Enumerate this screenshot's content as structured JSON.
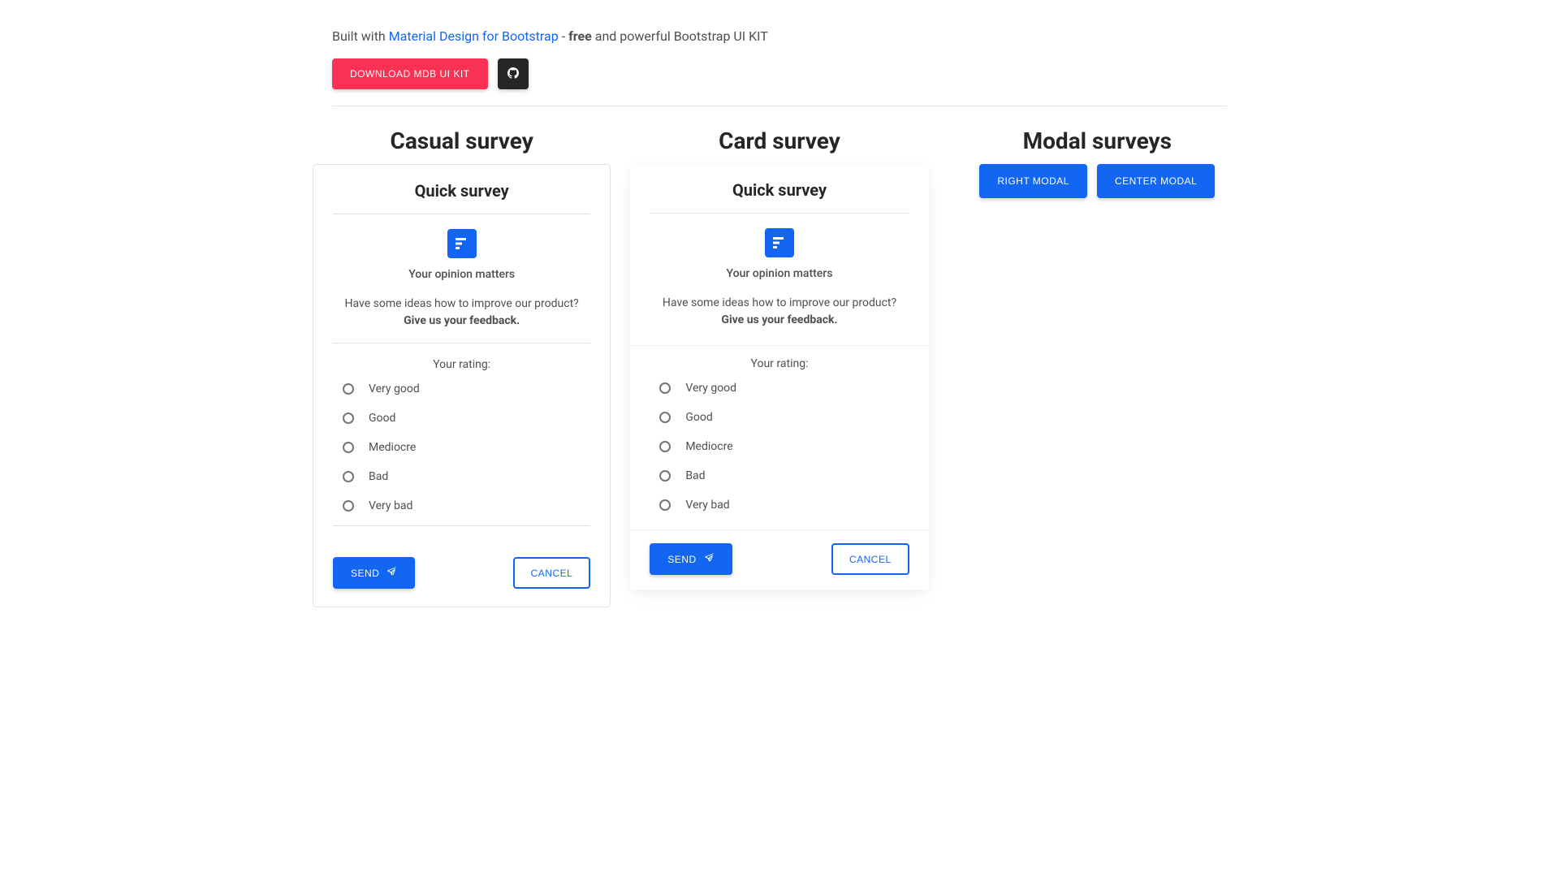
{
  "header": {
    "built_with": "Built with ",
    "mdb_link": "Material Design for Bootstrap",
    "dash": " - ",
    "free": "free",
    "rest": " and powerful Bootstrap UI KIT",
    "download": "DOWNLOAD MDB UI KIT"
  },
  "columns": {
    "casual": "Casual survey",
    "card": "Card survey",
    "modal": "Modal surveys"
  },
  "survey": {
    "title": "Quick survey",
    "opinion": "Your opinion matters",
    "ideas": "Have some ideas how to improve our product? ",
    "feedback": "Give us your feedback.",
    "rating_label": "Your rating:",
    "options": [
      "Very good",
      "Good",
      "Mediocre",
      "Bad",
      "Very bad"
    ],
    "send": "SEND",
    "cancel": "CANCEL"
  },
  "modal_buttons": {
    "right": "RIGHT MODAL",
    "center": "CENTER MODAL"
  }
}
